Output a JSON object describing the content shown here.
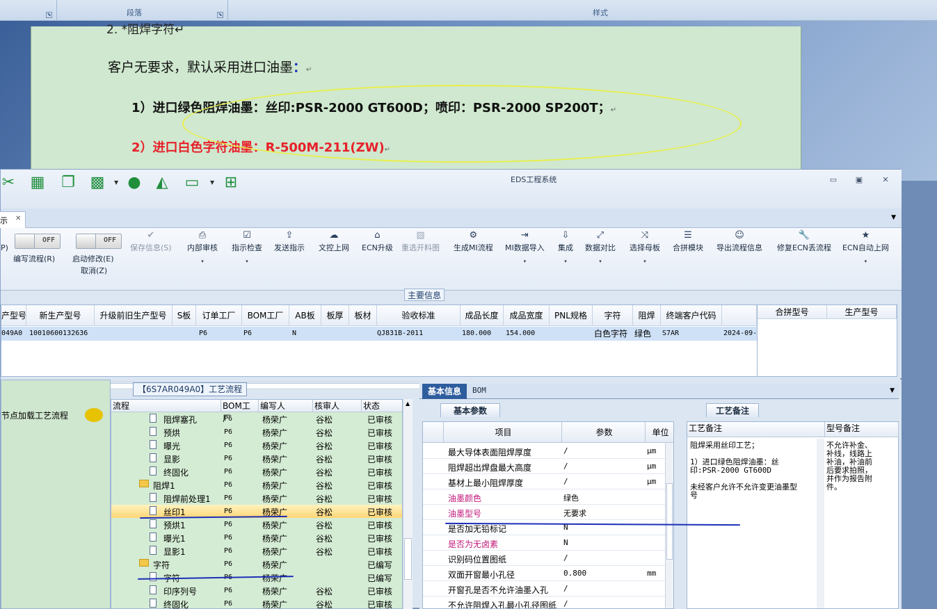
{
  "word": {
    "ribbon": {
      "paragraph_label": "段落",
      "styles_label": "样式"
    },
    "line_top": "2. *阻焊字符↵",
    "line1": "客户无要求，默认采用进口油墨",
    "line1_colon": "：",
    "line1_mark": "↵",
    "line2": "1）进口绿色阻焊油墨：丝印:PSR-2000 GT600D；喷印：PSR-2000 SP200T；",
    "line2_mark": "↵",
    "line3": "2）进口白色字符油墨：R-500M-211(ZW)",
    "line3_mark": "↵"
  },
  "window": {
    "title": "EDS工程系统",
    "controls": {
      "minimize": "▭",
      "restore": "▣",
      "close": "✕"
    },
    "tab_close": "✕",
    "tab_partial": "示"
  },
  "quick_icons": [
    "scissors-icon",
    "film-icon",
    "copy-icon",
    "grid-icon",
    "user-icon",
    "chart-icon",
    "laptop-icon",
    "windows-icon"
  ],
  "toolbar": {
    "toggle_off": "OFF",
    "edit_flow": "编写流程(R)",
    "start_modify": "启动修改(E)",
    "cancel": "取消(Z)",
    "partial_left": "P)",
    "buttons": [
      {
        "label": "保存信息(S)",
        "icon": "✔",
        "disabled": true
      },
      {
        "label": "内部审核",
        "icon": "⎙",
        "dropdown": true
      },
      {
        "label": "指示检查",
        "icon": "☑",
        "dropdown": true
      },
      {
        "label": "发送指示",
        "icon": "⇪"
      },
      {
        "label": "文控上网",
        "icon": "☁"
      },
      {
        "label": "ECN升级",
        "icon": "⌂"
      },
      {
        "label": "重选开料图",
        "icon": "▨",
        "disabled": true
      },
      {
        "label": "生成MI流程",
        "icon": "⚙"
      },
      {
        "label": "MI数据导入",
        "icon": "⇥",
        "dropdown": true
      },
      {
        "label": "集成",
        "icon": "⇩",
        "dropdown": true
      },
      {
        "label": "数据对比",
        "icon": "⤢",
        "dropdown": true
      },
      {
        "label": "选择母板",
        "icon": "⤨",
        "dropdown": true
      },
      {
        "label": "合拼模块",
        "icon": "☰"
      },
      {
        "label": "导出流程信息",
        "icon": "☺"
      },
      {
        "label": "修复ECN丢流程",
        "icon": "🔧"
      },
      {
        "label": "ECN自动上网",
        "icon": "★",
        "dropdown": true
      }
    ],
    "dropdown_glyph": "▾"
  },
  "main_info": {
    "legend": "主要信息",
    "columns": [
      "产型号",
      "新生产型号",
      "升级前旧生产型号",
      "S板",
      "订单工厂",
      "BOM工厂",
      "AB板",
      "板厚",
      "板材",
      "验收标准",
      "成品长度",
      "成品宽度",
      "PNL规格",
      "字符",
      "阻焊",
      "终端客户代码"
    ],
    "row": [
      "049A0",
      "10010600132636",
      "",
      "",
      "P6",
      "P6",
      "N",
      "",
      "",
      "QJ831B-2011",
      "180.000",
      "154.000",
      "",
      "白色字符",
      "绿色",
      "S7AR",
      "2024-09-"
    ],
    "side_columns": [
      "合拼型号",
      "生产型号"
    ]
  },
  "left_pane": {
    "text": "节点加载工艺流程"
  },
  "process": {
    "legend": "【6S7AR049A0】工艺流程",
    "columns": [
      "流程",
      "BOM工厂",
      "编写人",
      "核审人",
      "状态"
    ],
    "rows": [
      {
        "type": "doc",
        "name": "阻焊塞孔",
        "bom": "P6",
        "writer": "杨荣广",
        "checker": "谷松",
        "status": "已审核"
      },
      {
        "type": "doc",
        "name": "预烘",
        "bom": "P6",
        "writer": "杨荣广",
        "checker": "谷松",
        "status": "已审核"
      },
      {
        "type": "doc",
        "name": "曝光",
        "bom": "P6",
        "writer": "杨荣广",
        "checker": "谷松",
        "status": "已审核"
      },
      {
        "type": "doc",
        "name": "显影",
        "bom": "P6",
        "writer": "杨荣广",
        "checker": "谷松",
        "status": "已审核"
      },
      {
        "type": "doc",
        "name": "终固化",
        "bom": "P6",
        "writer": "杨荣广",
        "checker": "谷松",
        "status": "已审核"
      },
      {
        "type": "folder",
        "name": "阻焊1",
        "bom": "P6",
        "writer": "杨荣广",
        "checker": "谷松",
        "status": "已审核"
      },
      {
        "type": "doc",
        "name": "阻焊前处理1",
        "bom": "P6",
        "writer": "杨荣广",
        "checker": "谷松",
        "status": "已审核"
      },
      {
        "type": "doc",
        "name": "丝印1",
        "bom": "P6",
        "writer": "杨荣广",
        "checker": "谷松",
        "status": "已审核",
        "selected": true
      },
      {
        "type": "doc",
        "name": "预烘1",
        "bom": "P6",
        "writer": "杨荣广",
        "checker": "谷松",
        "status": "已审核"
      },
      {
        "type": "doc",
        "name": "曝光1",
        "bom": "P6",
        "writer": "杨荣广",
        "checker": "谷松",
        "status": "已审核"
      },
      {
        "type": "doc",
        "name": "显影1",
        "bom": "P6",
        "writer": "杨荣广",
        "checker": "谷松",
        "status": "已审核"
      },
      {
        "type": "folder",
        "name": "字符",
        "bom": "P6",
        "writer": "杨荣广",
        "checker": "",
        "status": "已编写"
      },
      {
        "type": "doc",
        "name": "字符",
        "bom": "P6",
        "writer": "杨荣广",
        "checker": "",
        "status": "已编写"
      },
      {
        "type": "doc",
        "name": "印序列号",
        "bom": "P6",
        "writer": "杨荣广",
        "checker": "谷松",
        "status": "已审核"
      },
      {
        "type": "doc",
        "name": "终固化",
        "bom": "P6",
        "writer": "杨荣广",
        "checker": "谷松",
        "status": "已审核"
      }
    ]
  },
  "detail": {
    "tab_basic": "基本信息",
    "tab_bom": "BOM",
    "subtab_params": "基本参数",
    "subtab_notes": "工艺备注",
    "param_columns": [
      "项目",
      "参数",
      "单位"
    ],
    "params": [
      {
        "item": "最大导体表面阻焊厚度",
        "value": "/",
        "unit": "μm",
        "pink": false
      },
      {
        "item": "阻焊超出焊盘最大高度",
        "value": "/",
        "unit": "μm",
        "pink": false
      },
      {
        "item": "基材上最小阻焊厚度",
        "value": "/",
        "unit": "μm",
        "pink": false
      },
      {
        "item": "油墨颜色",
        "value": "绿色",
        "unit": "",
        "pink": true
      },
      {
        "item": "油墨型号",
        "value": "无要求",
        "unit": "",
        "pink": true
      },
      {
        "item": "是否加无铅标记",
        "value": "N",
        "unit": "",
        "pink": false
      },
      {
        "item": "是否为无卤素",
        "value": "N",
        "unit": "",
        "pink": true
      },
      {
        "item": "识别码位置图纸",
        "value": "/",
        "unit": "",
        "pink": false
      },
      {
        "item": "双面开窗最小孔径",
        "value": "0.800",
        "unit": "mm",
        "pink": false
      },
      {
        "item": "开窗孔是否不允许油墨入孔",
        "value": "/",
        "unit": "",
        "pink": false
      },
      {
        "item": "不允许阻焊入孔最小孔径图纸",
        "value": "/",
        "unit": "",
        "pink": false
      }
    ],
    "note_columns": [
      "工艺备注",
      "型号备注"
    ],
    "note_text": "阻焊采用丝印工艺；\n\n1）进口绿色阻焊油墨：丝\n印:PSR-2000 GT600D\n\n未经客户允许不允许变更油墨型\n号",
    "model_note": "不允许补金、\n补线，线路上\n补油，补油前\n后要求拍照，\n并作为报告附\n件。"
  },
  "colors": {
    "highlight_ellipse": "#e9ee4a",
    "red_text": "#e8202a",
    "annotation_blue": "#1d2fb8",
    "pink_label": "#c0187a"
  }
}
